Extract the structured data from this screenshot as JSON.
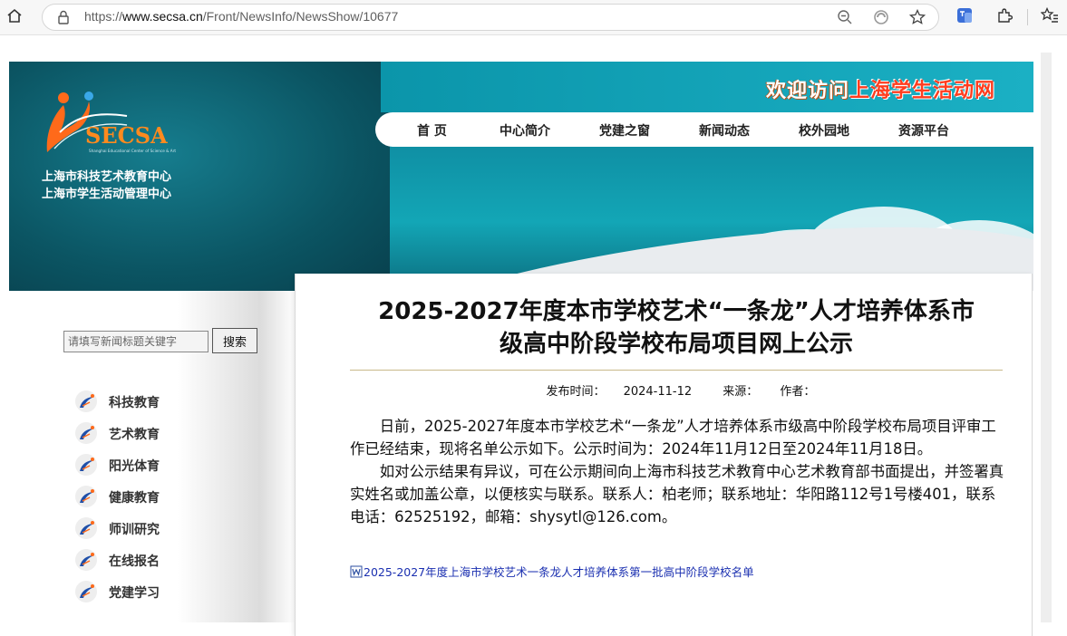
{
  "browser": {
    "url_prefix": "https://",
    "url_domain": "www.secsa.cn",
    "url_path": "/Front/NewsInfo/NewsShow/10677"
  },
  "header": {
    "logo_text": "SECSA",
    "logo_subtext": "Shanghai Educational Center of Science & Art",
    "org_line1": "上海市科技艺术教育中心",
    "org_line2": "上海市学生活动管理中心",
    "welcome_prefix": "欢迎访问",
    "welcome_highlight": "上海学生活动网"
  },
  "nav": {
    "items": [
      {
        "label": "首 页"
      },
      {
        "label": "中心简介"
      },
      {
        "label": "党建之窗"
      },
      {
        "label": "新闻动态"
      },
      {
        "label": "校外园地"
      },
      {
        "label": "资源平台"
      }
    ]
  },
  "sidebar": {
    "search_placeholder": "请填写新闻标题关键字",
    "search_button": "搜索",
    "items": [
      {
        "label": "科技教育"
      },
      {
        "label": "艺术教育"
      },
      {
        "label": "阳光体育"
      },
      {
        "label": "健康教育"
      },
      {
        "label": "师训研究"
      },
      {
        "label": "在线报名"
      },
      {
        "label": "党建学习"
      }
    ]
  },
  "article": {
    "title_line1": "2025-2027年度本市学校艺术“一条龙”人才培养体系市",
    "title_line2": "级高中阶段学校布局项目网上公示",
    "publish_label": "发布时间：",
    "publish_date": "2024-11-12",
    "source_label": "来源：",
    "author_label": "作者：",
    "para1": "日前，2025-2027年度本市学校艺术“一条龙”人才培养体系市级高中阶段学校布局项目评审工作已经结束，现将名单公示如下。公示时间为：2024年11月12日至2024年11月18日。",
    "para2": "如对公示结果有异议，可在公示期间向上海市科技艺术教育中心艺术教育部书面提出，并签署真实姓名或加盖公章，以便核实与联系。联系人：柏老师；联系地址：华阳路112号1号楼401，联系电话：62525192，邮箱：shysytl@126.com。",
    "attachment": "2025-2027年度上海市学校艺术一条龙人才培养体系第一批高中阶段学校名单"
  },
  "colors": {
    "banner": "#0f8ea3",
    "link": "#1a2fb0",
    "welcome_highlight": "#ff3d1f",
    "title_rule": "#c9b98a"
  }
}
